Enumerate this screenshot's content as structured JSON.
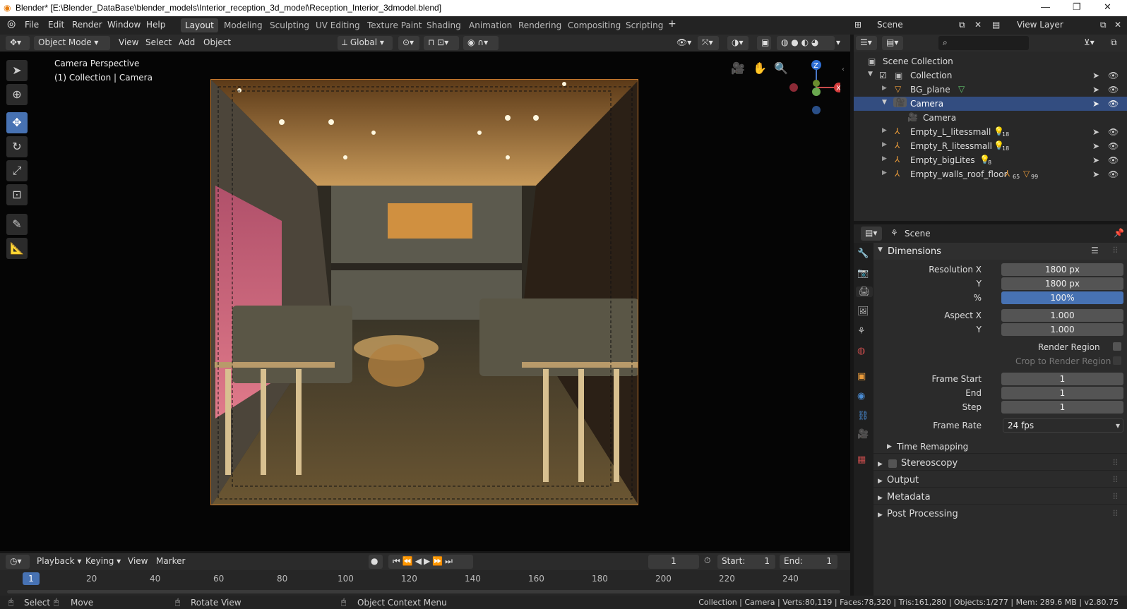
{
  "window": {
    "title": "Blender* [E:\\Blender_DataBase\\blender_models\\Interior_reception_3d_model\\Reception_Interior_3dmodel.blend]",
    "minimize": "—",
    "maximize": "❐",
    "close": "✕"
  },
  "menu": {
    "file": "File",
    "edit": "Edit",
    "render": "Render",
    "window": "Window",
    "help": "Help"
  },
  "workspaces": [
    "Layout",
    "Modeling",
    "Sculpting",
    "UV Editing",
    "Texture Paint",
    "Shading",
    "Animation",
    "Rendering",
    "Compositing",
    "Scripting"
  ],
  "scene_name": "Scene",
  "view_layer": "View Layer",
  "viewport": {
    "mode": "Object Mode",
    "view": "View",
    "select": "Select",
    "add": "Add",
    "object": "Object",
    "orientation": "Global",
    "overlay_title": "Camera Perspective",
    "overlay_sub": "(1) Collection | Camera",
    "axis_z": "Z",
    "axis_x": "X"
  },
  "outliner": {
    "rows": [
      {
        "label": "Scene Collection"
      },
      {
        "label": "Collection"
      },
      {
        "label": "BG_plane"
      },
      {
        "label": "Camera"
      },
      {
        "label": "Camera"
      },
      {
        "label": "Empty_L_litessmall",
        "badge": "18"
      },
      {
        "label": "Empty_R_litessmall",
        "badge": "18"
      },
      {
        "label": "Empty_bigLites",
        "badge": "8"
      },
      {
        "label": "Empty_walls_roof_floor",
        "badge": "65",
        "badge2": "99"
      }
    ]
  },
  "properties": {
    "context": "Scene",
    "dimensions": "Dimensions",
    "res_x_label": "Resolution X",
    "res_x": "1800 px",
    "res_y_label": "Y",
    "res_y": "1800 px",
    "pct_label": "%",
    "pct": "100%",
    "aspect_x_label": "Aspect X",
    "aspect_x": "1.000",
    "aspect_y_label": "Y",
    "aspect_y": "1.000",
    "render_region": "Render Region",
    "crop_region": "Crop to Render Region",
    "frame_start_label": "Frame Start",
    "frame_start": "1",
    "end_label": "End",
    "end": "1",
    "step_label": "Step",
    "step": "1",
    "frame_rate_label": "Frame Rate",
    "frame_rate": "24 fps",
    "time_remap": "Time Remapping",
    "stereoscopy": "Stereoscopy",
    "output": "Output",
    "metadata": "Metadata",
    "post": "Post Processing"
  },
  "timeline": {
    "playback": "Playback",
    "keying": "Keying",
    "view": "View",
    "marker": "Marker",
    "current": "1",
    "start_label": "Start:",
    "start": "1",
    "end_label": "End:",
    "end": "1",
    "ticks": [
      "1",
      "20",
      "40",
      "60",
      "80",
      "100",
      "120",
      "140",
      "160",
      "180",
      "200",
      "220",
      "240"
    ]
  },
  "status": {
    "select": "Select",
    "move": "Move",
    "rotate": "Rotate View",
    "context": "Object Context Menu",
    "info": "Collection | Camera | Verts:80,119 | Faces:78,320 | Tris:161,280 | Objects:1/277 | Mem: 289.6 MB | v2.80.75"
  }
}
